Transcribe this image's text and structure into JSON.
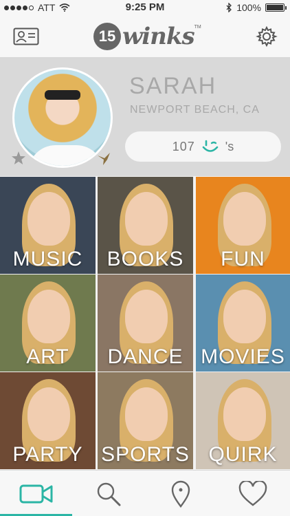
{
  "status_bar": {
    "carrier": "ATT",
    "time": "9:25 PM",
    "battery": "100%",
    "battery_level": 1.0,
    "signal_bars_filled": 4
  },
  "header": {
    "logo_number": "15",
    "logo_word": "winks",
    "logo_tm": "TM",
    "left_icon": "profile-card-icon",
    "right_icon": "gear-icon"
  },
  "profile": {
    "name": "SARAH",
    "location": "NEWPORT BEACH, CA",
    "winks_count": "107",
    "winks_suffix": "'s",
    "star_icon": "star-icon",
    "badge_icon": "hummingbird-icon"
  },
  "categories": [
    {
      "label": "MUSIC",
      "bg": "#3a4656"
    },
    {
      "label": "BOOKS",
      "bg": "#5a5448"
    },
    {
      "label": "FUN",
      "bg": "#e8851e"
    },
    {
      "label": "ART",
      "bg": "#6f7a4e"
    },
    {
      "label": "DANCE",
      "bg": "#8a7664"
    },
    {
      "label": "MOVIES",
      "bg": "#5a8fb0"
    },
    {
      "label": "PARTY",
      "bg": "#6e4a34"
    },
    {
      "label": "SPORTS",
      "bg": "#8d7a60"
    },
    {
      "label": "QUIRK",
      "bg": "#cfc4b6"
    }
  ],
  "tab_bar": {
    "tabs": [
      {
        "icon": "video-camera-icon",
        "active": true
      },
      {
        "icon": "search-icon",
        "active": false
      },
      {
        "icon": "location-pin-icon",
        "active": false
      },
      {
        "icon": "heart-icon",
        "active": false
      }
    ]
  },
  "colors": {
    "accent": "#2bb5a5",
    "icon_gray": "#666666",
    "text_gray": "#a8a8a8"
  }
}
